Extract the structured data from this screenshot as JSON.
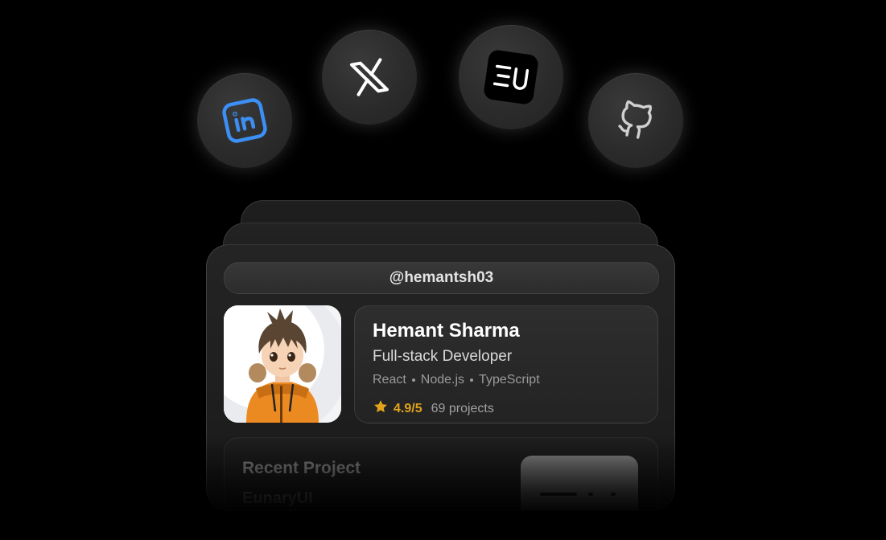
{
  "socials": [
    {
      "name": "LinkedIn",
      "icon": "linkedin-icon",
      "color": "#3b8ff5"
    },
    {
      "name": "X",
      "icon": "x-icon",
      "color": "#ffffff"
    },
    {
      "name": "EU",
      "icon": "eu-logo-icon",
      "color": "#ffffff"
    },
    {
      "name": "GitHub",
      "icon": "github-icon",
      "color": "#d0d0d0"
    }
  ],
  "profile": {
    "handle": "@hemantsh03",
    "name": "Hemant Sharma",
    "role": "Full-stack Developer",
    "skills": [
      "React",
      "Node.js",
      "TypeScript"
    ],
    "rating": "4.9/5",
    "projects": "69 projects",
    "avatar_icon": "avatar-boy-illustration"
  },
  "recent": {
    "title": "Recent Project",
    "subtitle": "EunaryUI"
  },
  "colors": {
    "background": "#000000",
    "accent_star": "#e2a41c",
    "linkedin_blue": "#3b8ff5"
  }
}
